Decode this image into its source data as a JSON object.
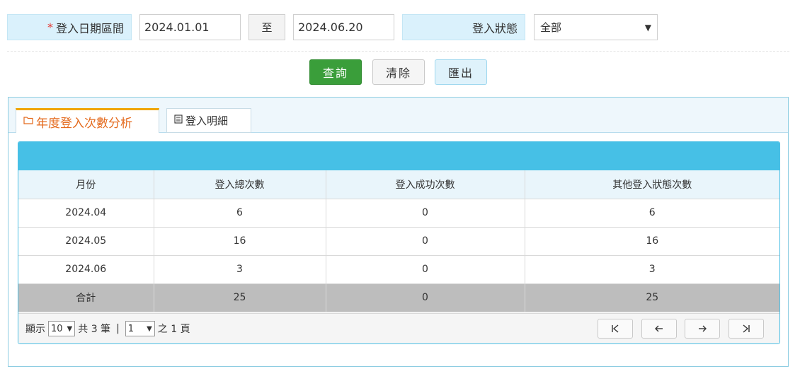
{
  "filters": {
    "date_range_required_mark": "*",
    "date_range_label": "登入日期區間",
    "date_from": "2024.01.01",
    "range_separator": "至",
    "date_to": "2024.06.20",
    "status_label": "登入狀態",
    "status_selected": "全部"
  },
  "actions": {
    "query": "查詢",
    "clear": "清除",
    "export": "匯出"
  },
  "tabs": [
    {
      "label": "年度登入次數分析",
      "icon": "folder-icon",
      "active": true
    },
    {
      "label": "登入明細",
      "icon": "document-icon",
      "active": false
    }
  ],
  "table": {
    "columns": [
      "月份",
      "登入總次數",
      "登入成功次數",
      "其他登入狀態次數"
    ],
    "rows": [
      [
        "2024.04",
        "6",
        "0",
        "6"
      ],
      [
        "2024.05",
        "16",
        "0",
        "16"
      ],
      [
        "2024.06",
        "3",
        "0",
        "3"
      ]
    ],
    "total": [
      "合計",
      "25",
      "0",
      "25"
    ]
  },
  "pager": {
    "show_label": "顯示",
    "page_size": "10",
    "total_text": "共 3 筆",
    "divider": "|",
    "page": "1",
    "of_text": "之 1 頁"
  },
  "colors": {
    "accent": "#46c0e6",
    "query_button": "#3a9e3a",
    "active_tab_text": "#e46a1d",
    "active_tab_border": "#f0a500",
    "total_row": "#bdbdbd"
  }
}
